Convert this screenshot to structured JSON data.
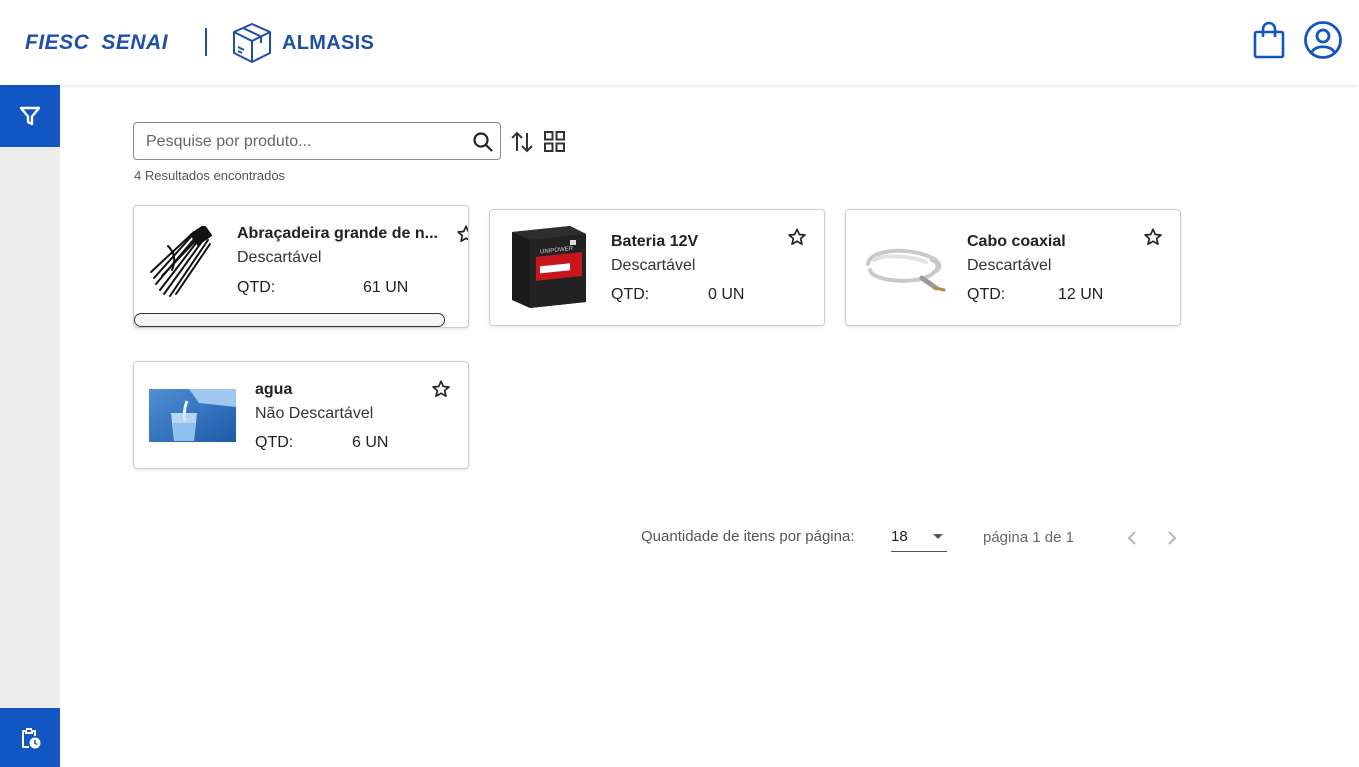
{
  "header": {
    "brand_primary": "FIESC",
    "brand_secondary": "SENAI",
    "app_name": "ALMASIS",
    "brand_color": "#1f4fa8",
    "icons": [
      "shopping-bag-icon",
      "user-account-icon"
    ]
  },
  "sidebar": {
    "accent_color": "#1256c4",
    "icons": [
      "filter-icon",
      "clipboard-clock-icon"
    ]
  },
  "search": {
    "placeholder": "Pesquise por produto...",
    "value": "",
    "results_text": "4 Resultados encontrados"
  },
  "products": [
    {
      "name": "Abraçadeira grande de n...",
      "type": "Descartável",
      "qtd_label": "QTD:",
      "qtd": "61 UN",
      "thumb": "cable-ties-image"
    },
    {
      "name": "Bateria 12V",
      "type": "Descartável",
      "qtd_label": "QTD:",
      "qtd": "0 UN",
      "thumb": "battery-image"
    },
    {
      "name": "Cabo coaxial",
      "type": "Descartável",
      "qtd_label": "QTD:",
      "qtd": "12 UN",
      "thumb": "coaxial-cable-image"
    },
    {
      "name": "agua",
      "type": "Não Descartável",
      "qtd_label": "QTD:",
      "qtd": "6 UN",
      "thumb": "water-glass-image"
    }
  ],
  "pagination": {
    "items_per_page_label": "Quantidade de itens por página:",
    "items_per_page": "18",
    "page_text": "página 1 de 1"
  }
}
